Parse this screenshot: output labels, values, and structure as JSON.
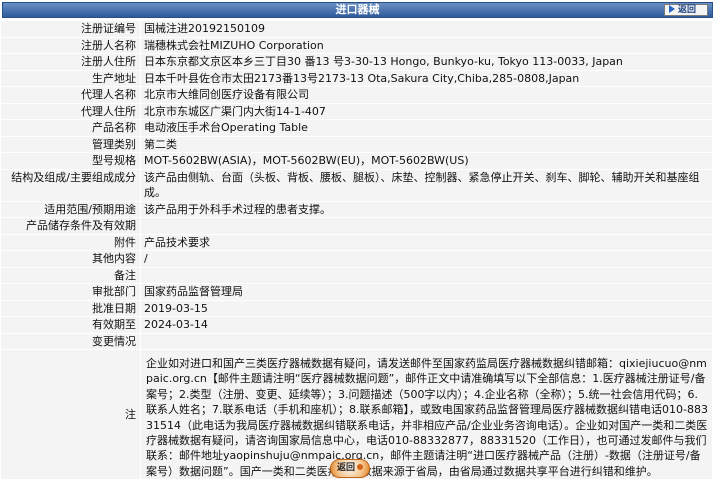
{
  "header": {
    "title": "进口器械",
    "back_label": "返回"
  },
  "rows": [
    {
      "label": "注册证编号",
      "value": "国械注进20192150109"
    },
    {
      "label": "注册人名称",
      "value": "瑞穗株式会社MIZUHO Corporation"
    },
    {
      "label": "注册人住所",
      "value": "日本东京都文京区本乡三丁目30 番13 号3-30-13 Hongo, Bunkyo-ku, Tokyo 113-0033, Japan"
    },
    {
      "label": "生产地址",
      "value": "日本千叶县佐仓市太田2173番13号2173-13 Ota,Sakura City,Chiba,285-0808,Japan"
    },
    {
      "label": "代理人名称",
      "value": "北京市大维同创医疗设备有限公司"
    },
    {
      "label": "代理人住所",
      "value": "北京市东城区广渠门内大街14-1-407"
    },
    {
      "label": "产品名称",
      "value": "电动液压手术台Operating Table"
    },
    {
      "label": "管理类别",
      "value": "第二类"
    },
    {
      "label": "型号规格",
      "value": "MOT-5602BW(ASIA)，MOT-5602BW(EU)，MOT-5602BW(US)"
    },
    {
      "label": "结构及组成/主要组成成分",
      "value": "该产品由侧轨、台面（头板、背板、腰板、腿板）、床垫、控制器、紧急停止开关、刹车、脚轮、辅助开关和基座组成。"
    },
    {
      "label": "适用范围/预期用途",
      "value": "该产品用于外科手术过程的患者支撑。"
    },
    {
      "label": "产品储存条件及有效期",
      "value": ""
    },
    {
      "label": "附件",
      "value": "产品技术要求"
    },
    {
      "label": "其他内容",
      "value": "/"
    },
    {
      "label": "备注",
      "value": ""
    },
    {
      "label": "审批部门",
      "value": "国家药品监督管理局"
    },
    {
      "label": "批准日期",
      "value": "2019-03-15"
    },
    {
      "label": "有效期至",
      "value": "2024-03-14"
    },
    {
      "label": "变更情况",
      "value": ""
    }
  ],
  "note": {
    "label": "注",
    "text": "企业如对进口和国产三类医疗器械数据有疑问，请发送邮件至国家药监局医疗器械数据纠错邮箱：qixiejiucuo@nmpaic.org.cn【邮件主题请注明“医疗器械数据问题”，邮件正文中请准确填写以下全部信息：1.医疗器械注册证号/备案号；2.类型（注册、变更、延续等）；3.问题描述（500字以内）；4.企业名称（全称）；5.统一社会信用代码；6.联系人姓名；7.联系电话（手机和座机）；8.联系邮箱】，或致电国家药品监督管理局医疗器械数据纠错电话010-88331514（此电话为我局医疗器械数据纠错联系电话，并非相应产品/企业业务咨询电话）。企业如对国产一类和二类医疗器械数据有疑问，请咨询国家局信息中心，电话010-88332877，88331520（工作日），也可通过发邮件与我们联系：邮件地址yaopinshuju@nmpaic.org.cn，邮件主题请注明“进口医疗器械产品（注册）-数据（注册证号/备案号）数据问题”。国产一类和二类医疗器械数据来源于省局，由省局通过数据共享平台进行纠错和维护。"
  },
  "footer": {
    "back_label": "返回"
  }
}
